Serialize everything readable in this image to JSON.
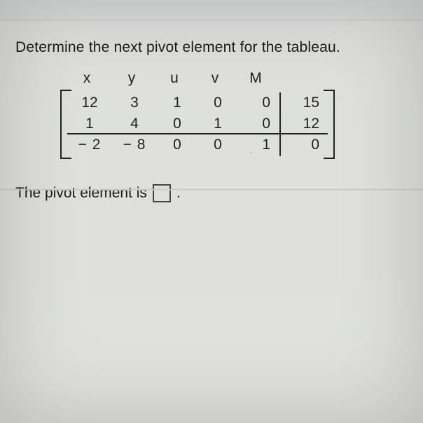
{
  "question": "Determine the next pivot element for the tableau.",
  "chart_data": {
    "type": "table",
    "title": "Simplex Tableau",
    "headers": [
      "x",
      "y",
      "u",
      "v",
      "M",
      ""
    ],
    "rows": [
      [
        12,
        3,
        1,
        0,
        0,
        15
      ],
      [
        1,
        4,
        0,
        1,
        0,
        12
      ],
      [
        -2,
        -8,
        0,
        0,
        1,
        0
      ]
    ],
    "partition": {
      "objective_row_index": 2,
      "rhs_column_index": 5
    }
  },
  "answer": {
    "prompt_before": "The pivot element is",
    "value": "",
    "prompt_after": "."
  }
}
